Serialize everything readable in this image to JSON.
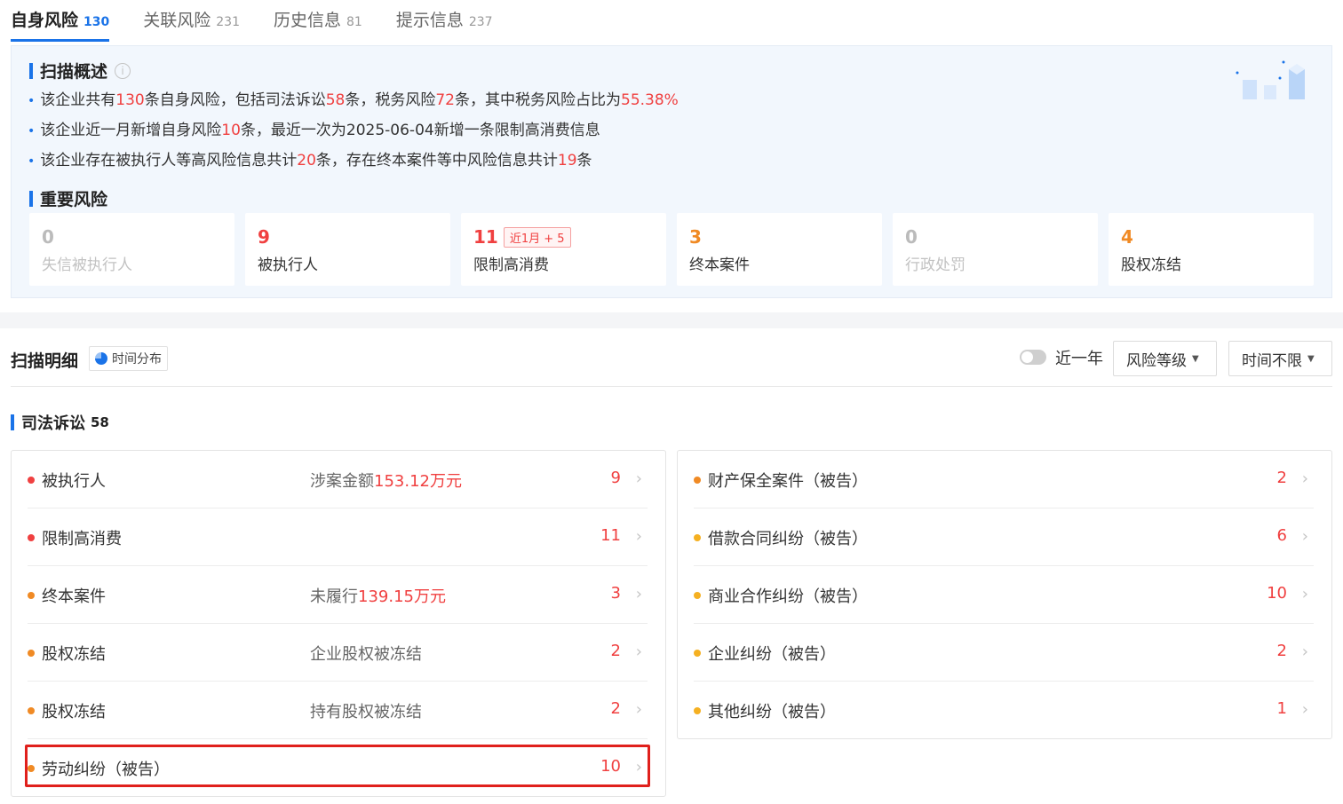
{
  "tabs": [
    {
      "label": "自身风险",
      "count": "130",
      "active": true
    },
    {
      "label": "关联风险",
      "count": "231"
    },
    {
      "label": "历史信息",
      "count": "81"
    },
    {
      "label": "提示信息",
      "count": "237"
    }
  ],
  "overview": {
    "title": "扫描概述",
    "info_icon": "i",
    "lines": [
      {
        "parts": [
          "该企业共有",
          "130",
          "条自身风险，包括司法诉讼",
          "58",
          "条，税务风险",
          "72",
          "条，其中税务风险占比为",
          "55.38%"
        ]
      },
      {
        "parts": [
          "该企业近一月新增自身风险",
          "10",
          "条，最近一次为2025-06-04新增一条限制高消费信息"
        ]
      },
      {
        "parts": [
          "该企业存在被执行人等高风险信息共计",
          "20",
          "条，存在终本案件等中风险信息共计",
          "19",
          "条"
        ]
      }
    ]
  },
  "important": {
    "title": "重要风险",
    "cards": [
      {
        "num": "0",
        "label": "失信被执行人",
        "tone": "zero"
      },
      {
        "num": "9",
        "label": "被执行人",
        "tone": "red"
      },
      {
        "num": "11",
        "label": "限制高消费",
        "tone": "red",
        "badge": "近1月 + 5"
      },
      {
        "num": "3",
        "label": "终本案件",
        "tone": "orange"
      },
      {
        "num": "0",
        "label": "行政处罚",
        "tone": "zero"
      },
      {
        "num": "4",
        "label": "股权冻结",
        "tone": "orange"
      }
    ]
  },
  "detail": {
    "title": "扫描明细",
    "time_dist": "时间分布",
    "toggle_label": "近一年",
    "risk_level": "风险等级",
    "time_filter": "时间不限"
  },
  "litigation": {
    "title": "司法诉讼",
    "count": "58",
    "left": [
      {
        "name": "被执行人",
        "desc_prefix": "涉案金额",
        "desc_value": "153.12万元",
        "count": "9",
        "level": "red"
      },
      {
        "name": "限制高消费",
        "desc_prefix": "",
        "desc_value": "",
        "count": "11",
        "level": "red"
      },
      {
        "name": "终本案件",
        "desc_prefix": "未履行",
        "desc_value": "139.15万元",
        "count": "3",
        "level": "orange"
      },
      {
        "name": "股权冻结",
        "desc_prefix": "企业股权被冻结",
        "desc_value": "",
        "count": "2",
        "level": "orange"
      },
      {
        "name": "股权冻结",
        "desc_prefix": "持有股权被冻结",
        "desc_value": "",
        "count": "2",
        "level": "orange"
      },
      {
        "name": "劳动纠纷（被告）",
        "desc_prefix": "",
        "desc_value": "",
        "count": "10",
        "level": "orange"
      }
    ],
    "right": [
      {
        "name": "财产保全案件（被告）",
        "count": "2",
        "level": "orange"
      },
      {
        "name": "借款合同纠纷（被告）",
        "count": "6",
        "level": "yellow"
      },
      {
        "name": "商业合作纠纷（被告）",
        "count": "10",
        "level": "yellow"
      },
      {
        "name": "企业纠纷（被告）",
        "count": "2",
        "level": "yellow"
      },
      {
        "name": "其他纠纷（被告）",
        "count": "1",
        "level": "yellow"
      }
    ]
  },
  "colors": {
    "accent": "#1a73e8",
    "red": "#f04040",
    "orange": "#f08a24",
    "yellow": "#f5b021",
    "highlight": "#e0201c"
  }
}
